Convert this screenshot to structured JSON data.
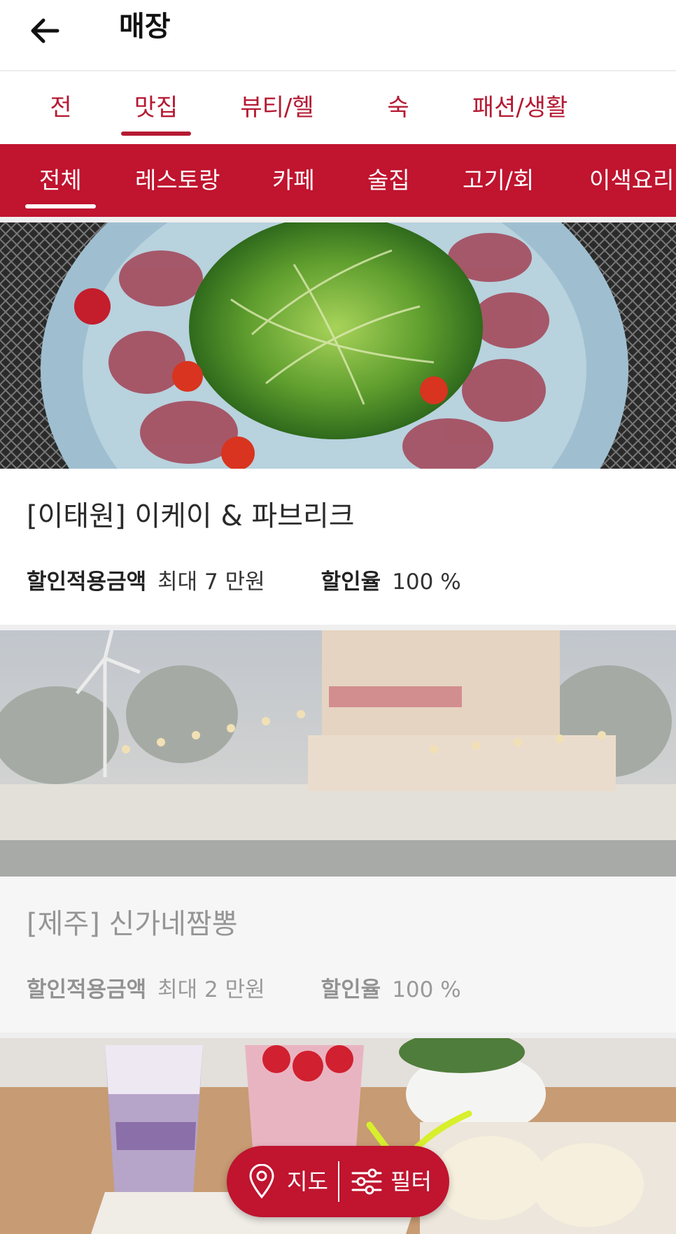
{
  "header": {
    "title": "매장"
  },
  "categories": [
    {
      "label": "전체",
      "active": false
    },
    {
      "label": "맛집",
      "active": true
    },
    {
      "label": "뷰티/헬스",
      "active": false
    },
    {
      "label": "숙박",
      "active": false
    },
    {
      "label": "패션/생활",
      "active": false
    }
  ],
  "subcategories": [
    {
      "label": "전체",
      "active": true
    },
    {
      "label": "레스토랑",
      "active": false
    },
    {
      "label": "카페",
      "active": false
    },
    {
      "label": "술집",
      "active": false
    },
    {
      "label": "고기/회",
      "active": false
    },
    {
      "label": "이색요리",
      "active": false
    }
  ],
  "stores": [
    {
      "name": "[이태원] 이케이 & 파브리크",
      "discount_amount_label": "할인적용금액",
      "discount_amount": "최대 7 만원",
      "discount_rate_label": "할인율",
      "discount_rate": "100 %",
      "dimmed": false
    },
    {
      "name": "[제주] 신가네짬뽕",
      "discount_amount_label": "할인적용금액",
      "discount_amount": "최대 2 만원",
      "discount_rate_label": "할인율",
      "discount_rate": "100 %",
      "dimmed": true
    }
  ],
  "fab": {
    "map_label": "지도",
    "filter_label": "필터"
  },
  "colors": {
    "brand": "#c0142f",
    "brand_text": "#b51a33"
  }
}
